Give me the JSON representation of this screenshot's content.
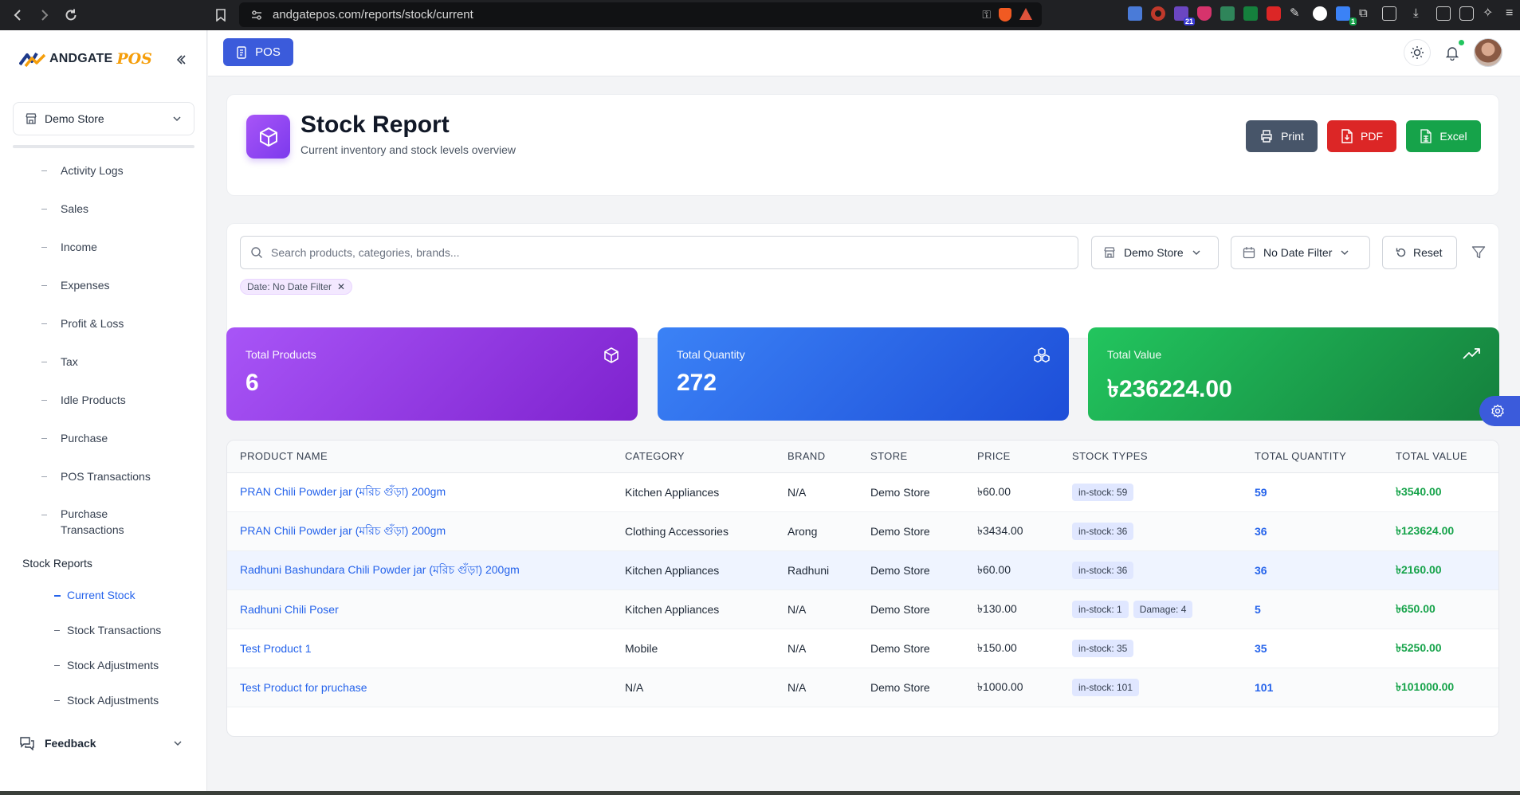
{
  "browser": {
    "url": "andgatepos.com/reports/stock/current",
    "ext_badges": [
      "21",
      "1"
    ]
  },
  "sidebar": {
    "brand": "ANDGATE",
    "brand_pos": "POS",
    "store": "Demo Store",
    "items": [
      {
        "label": "Activity Logs"
      },
      {
        "label": "Sales"
      },
      {
        "label": "Income"
      },
      {
        "label": "Expenses"
      },
      {
        "label": "Profit & Loss"
      },
      {
        "label": "Tax"
      },
      {
        "label": "Idle Products"
      },
      {
        "label": "Purchase"
      },
      {
        "label": "POS Transactions"
      },
      {
        "label": "Purchase Transactions"
      }
    ],
    "section": "Stock Reports",
    "sub_items": [
      {
        "label": "Current Stock",
        "active": true
      },
      {
        "label": "Stock Transactions",
        "active": false
      },
      {
        "label": "Stock Adjustments",
        "active": false
      },
      {
        "label": "Stock Adjustments",
        "active": false
      }
    ],
    "feedback": "Feedback"
  },
  "topbar": {
    "pos_label": "POS"
  },
  "header": {
    "title": "Stock Report",
    "subtitle": "Current inventory and stock levels overview",
    "print_label": "Print",
    "pdf_label": "PDF",
    "excel_label": "Excel"
  },
  "filters": {
    "search_placeholder": "Search products, categories, brands...",
    "store": "Demo Store",
    "date": "No Date Filter",
    "reset": "Reset",
    "chip": "Date: No Date Filter"
  },
  "stats": [
    {
      "label": "Total Products",
      "value": "6",
      "color": "#9333ea",
      "icon": "cube-icon"
    },
    {
      "label": "Total Quantity",
      "value": "272",
      "color": "#2563eb",
      "icon": "cubes-icon"
    },
    {
      "label": "Total Value",
      "value": "৳236224.00",
      "color": "#16a34a",
      "icon": "trend-up-icon"
    }
  ],
  "table": {
    "headers": [
      "PRODUCT NAME",
      "CATEGORY",
      "BRAND",
      "STORE",
      "PRICE",
      "STOCK TYPES",
      "TOTAL QUANTITY",
      "TOTAL VALUE"
    ],
    "rows": [
      {
        "name": "PRAN Chili Powder jar (মরিচ গুঁড়া) 200gm",
        "category": "Kitchen Appliances",
        "brand": "N/A",
        "store": "Demo Store",
        "price": "৳60.00",
        "stock": [
          "in-stock: 59"
        ],
        "qty": "59",
        "value": "৳3540.00"
      },
      {
        "name": "PRAN Chili Powder jar (মরিচ গুঁড়া) 200gm",
        "category": "Clothing Accessories",
        "brand": "Arong",
        "store": "Demo Store",
        "price": "৳3434.00",
        "stock": [
          "in-stock: 36"
        ],
        "qty": "36",
        "value": "৳123624.00"
      },
      {
        "name": "Radhuni Bashundara Chili Powder jar (মরিচ গুঁড়া) 200gm",
        "category": "Kitchen Appliances",
        "brand": "Radhuni",
        "store": "Demo Store",
        "price": "৳60.00",
        "stock": [
          "in-stock: 36"
        ],
        "qty": "36",
        "value": "৳2160.00"
      },
      {
        "name": "Radhuni Chili Poser",
        "category": "Kitchen Appliances",
        "brand": "N/A",
        "store": "Demo Store",
        "price": "৳130.00",
        "stock": [
          "in-stock: 1",
          "Damage: 4"
        ],
        "qty": "5",
        "value": "৳650.00"
      },
      {
        "name": "Test Product 1",
        "category": "Mobile",
        "brand": "N/A",
        "store": "Demo Store",
        "price": "৳150.00",
        "stock": [
          "in-stock: 35"
        ],
        "qty": "35",
        "value": "৳5250.00"
      },
      {
        "name": "Test Product for pruchase",
        "category": "N/A",
        "brand": "N/A",
        "store": "Demo Store",
        "price": "৳1000.00",
        "stock": [
          "in-stock: 101"
        ],
        "qty": "101",
        "value": "৳101000.00"
      }
    ]
  }
}
